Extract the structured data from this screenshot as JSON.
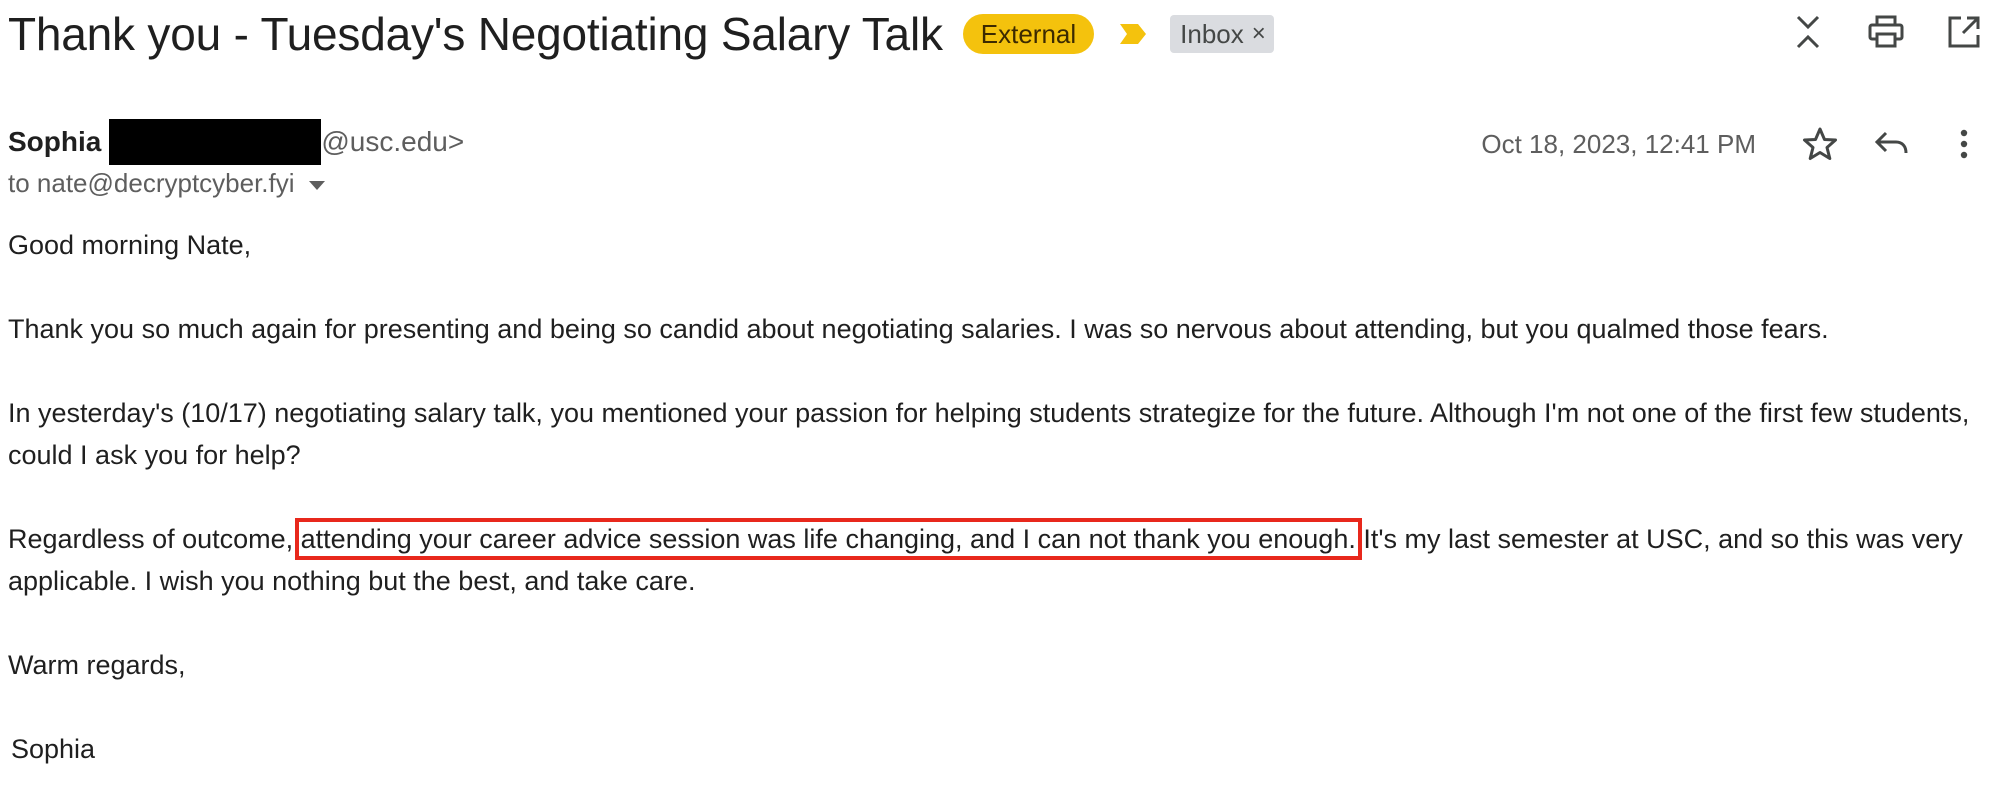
{
  "header": {
    "subject": "Thank you - Tuesday's Negotiating Salary Talk",
    "tags": {
      "external": "External",
      "inbox": "Inbox",
      "remove_symbol": "×"
    },
    "icons": [
      "collapse-icon",
      "print-icon",
      "open-in-new-window-icon"
    ]
  },
  "message": {
    "sender_name": "Sophia",
    "sender_email_suffix": "@usc.edu>",
    "to": "to nate@decryptcyber.fyi",
    "date": "Oct 18, 2023, 12:41 PM",
    "icons": [
      "star-icon",
      "reply-icon",
      "more-vert-icon"
    ]
  },
  "body": {
    "greeting": "Good morning Nate,",
    "para1": "Thank you so much again for presenting and being so candid about negotiating salaries. I was so nervous about attending, but you qualmed those fears.",
    "para2": "In yesterday's (10/17) negotiating salary talk, you mentioned your passion for helping students strategize for the future. Although I'm not one of the first few students, could I ask you for help?",
    "para3_start": "Regardless of outcome, ",
    "para3_highlight": "attending your career advice session was life changing, and I can not thank you enough.",
    "para3_end": " It's my last semester at USC, and so this was very applicable. I wish you nothing but the best, and take care.",
    "closing": "Warm regards,",
    "signature": "Sophia"
  },
  "colors": {
    "external_tag": "#f4c20d",
    "importance_marker": "#f4c20d",
    "highlight_box": "#e8281c",
    "redaction": "#000000"
  }
}
